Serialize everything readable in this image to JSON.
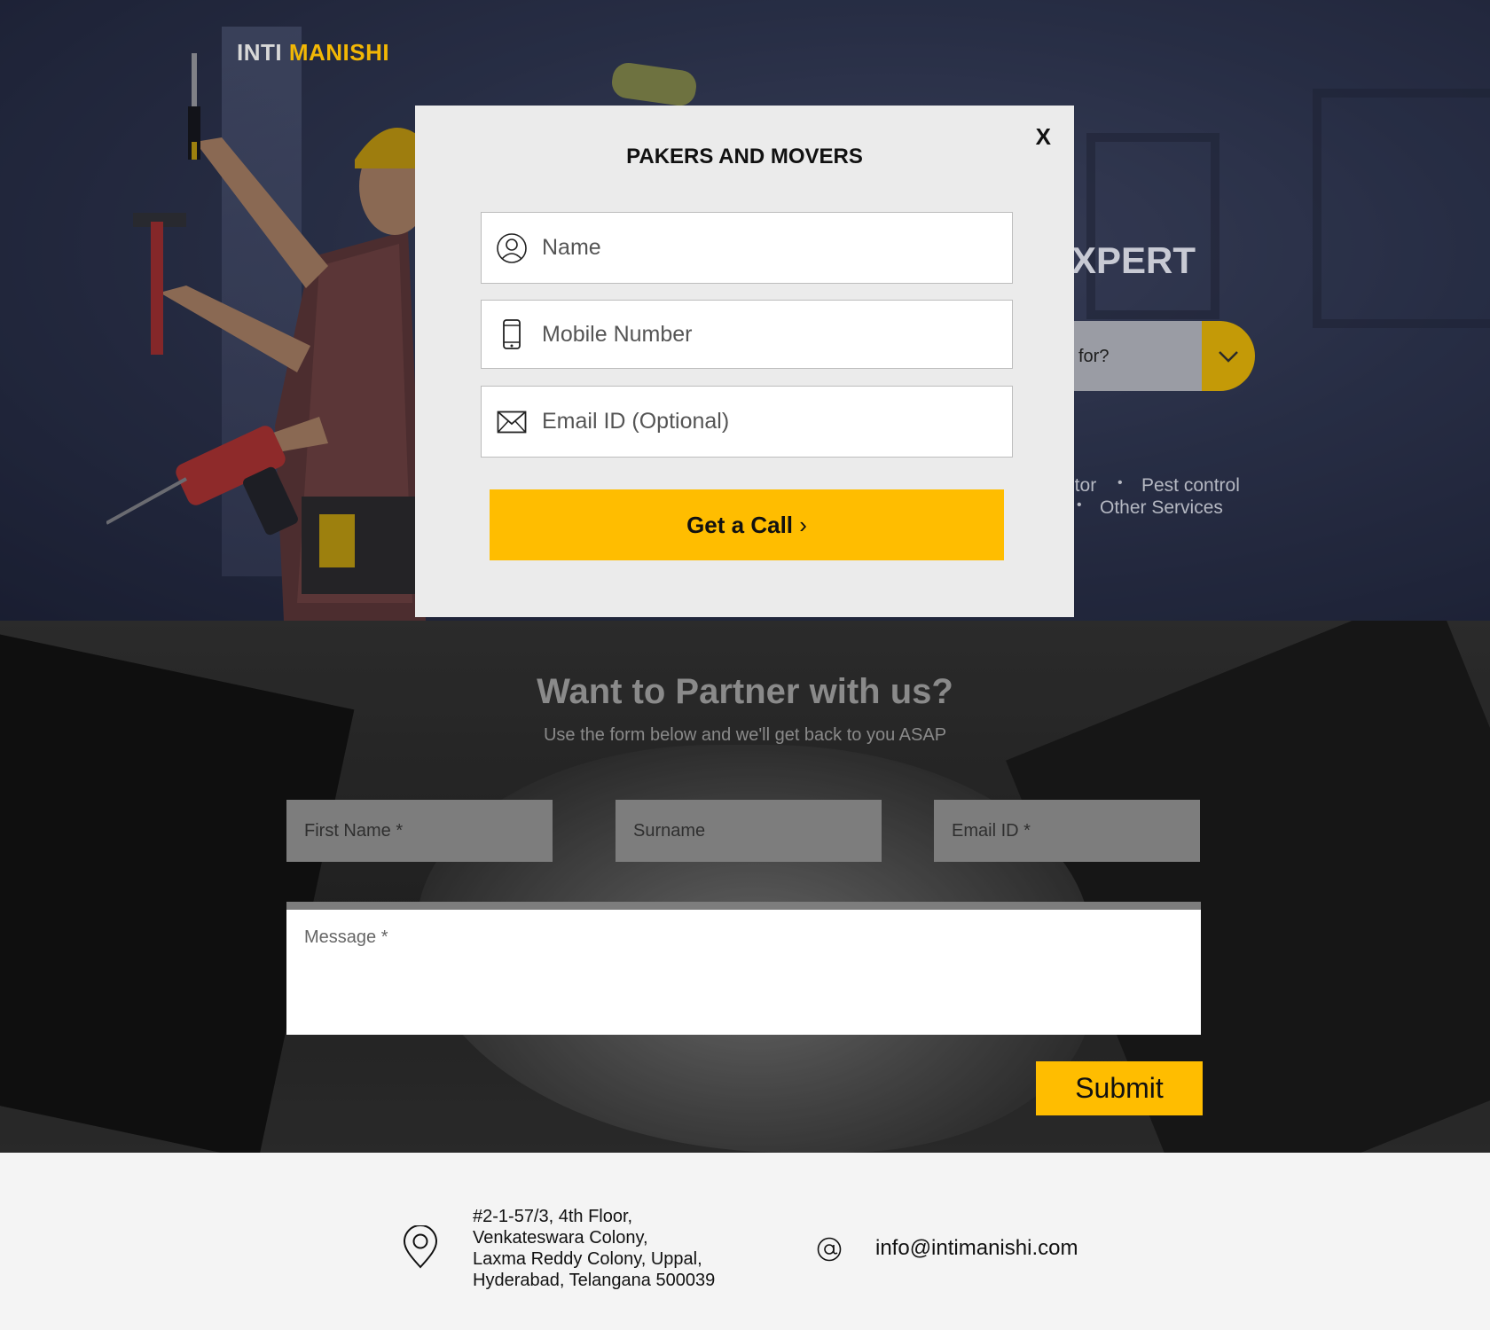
{
  "brand": {
    "logo_part1": "INTI",
    "logo_part2": "MANISHI"
  },
  "hero": {
    "heading_fragment": "XPERT",
    "search_fragment": "for?",
    "services_line1_a": "ntor",
    "services_line1_b": "Pest control",
    "services_line2": "Other Services",
    "bullet": "•"
  },
  "modal": {
    "close_label": "X",
    "title": "PAKERS AND MOVERS",
    "name_placeholder": "Name",
    "mobile_placeholder": "Mobile Number",
    "email_placeholder": "Email ID (Optional)",
    "cta_label": "Get a Call",
    "cta_chevron": "›"
  },
  "partner": {
    "title": "Want to Partner with us?",
    "subtitle": "Use the form below and we'll get back to you ASAP",
    "first_name_placeholder": "First Name *",
    "surname_placeholder": "Surname",
    "email_placeholder": "Email ID *",
    "message_placeholder": "Message *",
    "submit_label": "Submit"
  },
  "footer": {
    "address_lines": [
      "#2-1-57/3, 4th Floor,",
      "Venkateswara Colony,",
      "Laxma Reddy Colony, Uppal,",
      "Hyderabad, Telangana 500039"
    ],
    "email": "info@intimanishi.com"
  },
  "colors": {
    "accent": "#ffbd00",
    "modal_bg": "#ebebeb",
    "hero_bg": "#323a54"
  },
  "icons": [
    "user-icon",
    "phone-icon",
    "mail-icon",
    "map-pin-icon",
    "at-icon",
    "chevron-down-icon"
  ]
}
